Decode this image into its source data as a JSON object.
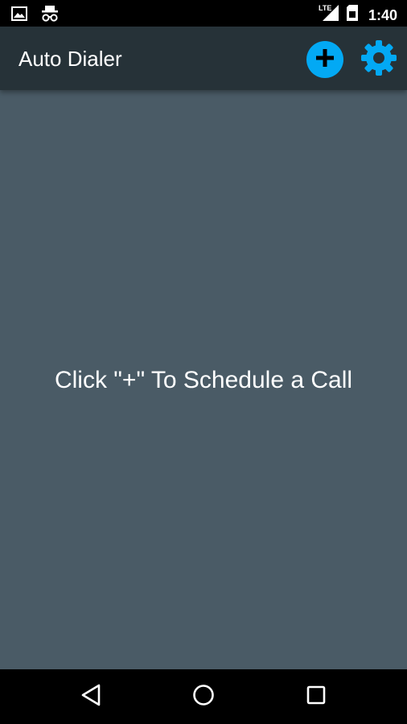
{
  "status_bar": {
    "time": "1:40",
    "network_label": "LTE",
    "left_icons": [
      "image-notification-icon",
      "incognito-icon"
    ],
    "right_icons": [
      "lte-signal-icon",
      "sim-card-icon"
    ]
  },
  "app_bar": {
    "title": "Auto Dialer",
    "actions": [
      {
        "name": "add-call-button",
        "icon": "plus-icon",
        "color": "#03a9f4"
      },
      {
        "name": "settings-button",
        "icon": "gear-icon",
        "color": "#03a9f4"
      }
    ]
  },
  "main": {
    "empty_message": "Click \"+\" To Schedule a Call"
  },
  "navigation_bar": {
    "buttons": [
      "back-icon",
      "home-icon",
      "recents-icon"
    ]
  },
  "colors": {
    "status_bar_bg": "#000000",
    "app_bar_bg": "#263238",
    "content_bg": "#4a5b66",
    "accent": "#03a9f4",
    "nav_bar_bg": "#000000",
    "text": "#ffffff"
  }
}
